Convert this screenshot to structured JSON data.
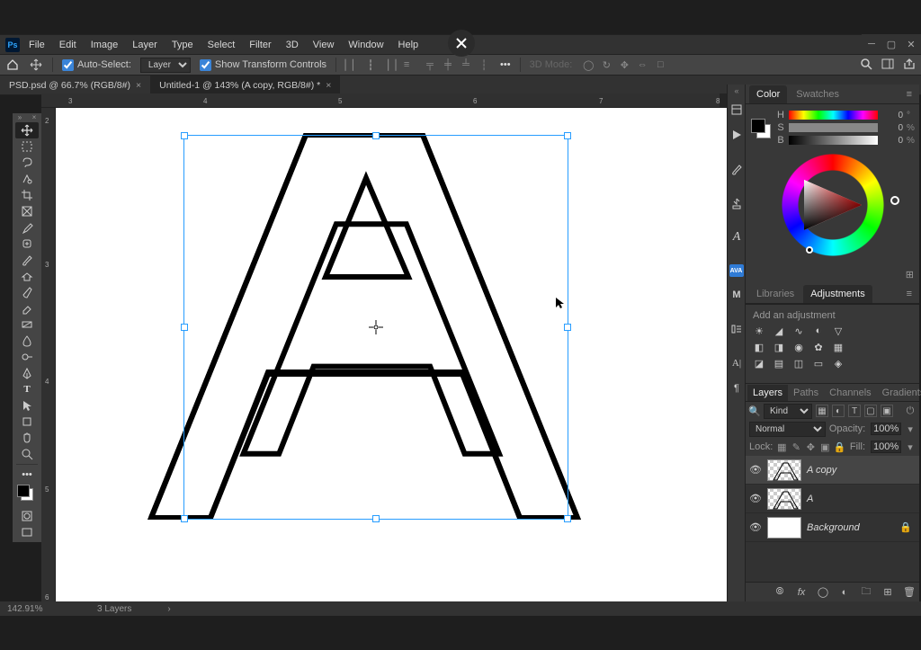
{
  "menu": {
    "items": [
      "File",
      "Edit",
      "Image",
      "Layer",
      "Type",
      "Select",
      "Filter",
      "3D",
      "View",
      "Window",
      "Help"
    ]
  },
  "options": {
    "auto_select_label": "Auto-Select:",
    "auto_select_target": "Layer",
    "show_transform_label": "Show Transform Controls",
    "mode_label": "3D Mode:"
  },
  "tabs": [
    {
      "title": "PSD.psd @ 66.7% (RGB/8#)",
      "active": false
    },
    {
      "title": "Untitled-1 @ 143% (A copy, RGB/8#) *",
      "active": true
    }
  ],
  "ruler_h": [
    "3",
    "4",
    "5",
    "6",
    "7",
    "8"
  ],
  "ruler_v": [
    "2",
    "3",
    "4",
    "5",
    "6"
  ],
  "color": {
    "tabs": [
      "Color",
      "Swatches"
    ],
    "h": {
      "label": "H",
      "value": "0",
      "unit": "°"
    },
    "s": {
      "label": "S",
      "value": "0",
      "unit": "%"
    },
    "b": {
      "label": "B",
      "value": "0",
      "unit": "%"
    }
  },
  "adjustments": {
    "tabs": [
      "Libraries",
      "Adjustments"
    ],
    "hint": "Add an adjustment"
  },
  "panelstrip": {
    "ava": "AVA",
    "m": "M"
  },
  "layers_panel": {
    "tabs": [
      "Layers",
      "Paths",
      "Channels",
      "Gradients"
    ],
    "kind_label": "Kind",
    "blend_mode": "Normal",
    "opacity_label": "Opacity:",
    "opacity_value": "100%",
    "lock_label": "Lock:",
    "fill_label": "Fill:",
    "fill_value": "100%",
    "layers": [
      {
        "name": "A copy",
        "visible": true,
        "transparent": true,
        "selected": true
      },
      {
        "name": "A",
        "visible": true,
        "transparent": true,
        "selected": false
      },
      {
        "name": "Background",
        "visible": true,
        "transparent": false,
        "selected": false,
        "locked": true
      }
    ]
  },
  "status": {
    "zoom": "142.91%",
    "info": "3 Layers"
  }
}
